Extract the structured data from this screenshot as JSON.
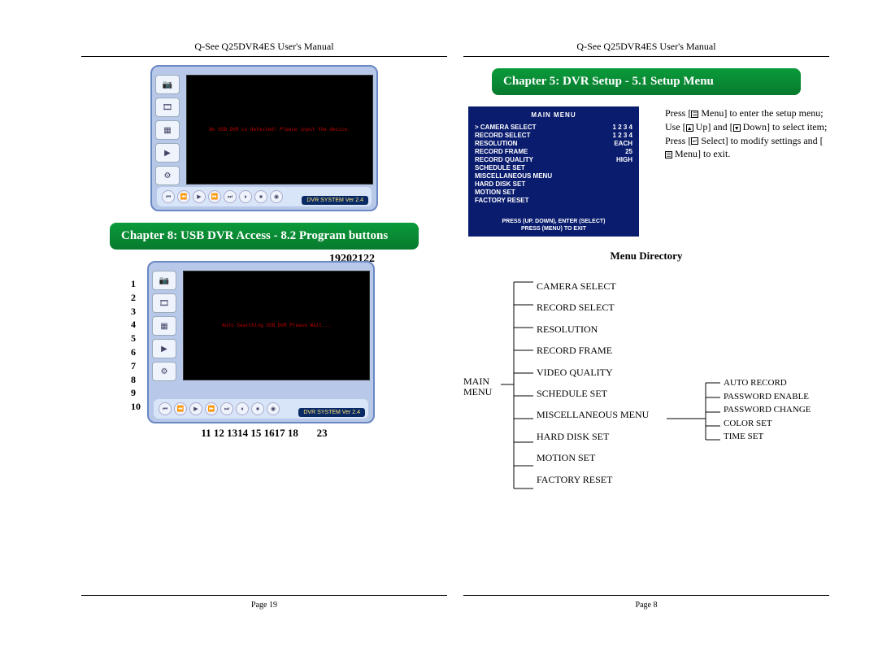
{
  "doc_header": "Q-See Q25DVR4ES User's Manual",
  "left_page": {
    "banner": "Chapter 8: USB DVR Access - 8.2 Program buttons",
    "player": {
      "footer_label": "DVR SYSTEM  Ver 2.4",
      "screen_msg_1": "No USB DVR is detected!  Please input the device.",
      "screen_msg_2": "Auto Searching USB DVR  Please Wait..."
    },
    "annot": {
      "top": "19202122",
      "side": [
        "1",
        "2",
        "3",
        "4",
        "5",
        "6",
        "7",
        "8",
        "9",
        "10"
      ],
      "bottom_a": "11 12 1314 15 1617  18",
      "bottom_b": "23"
    },
    "page_no": "Page 19"
  },
  "right_page": {
    "banner": "Chapter 5: DVR Setup - 5.1 Setup Menu",
    "main_menu": {
      "title": "MAIN MENU",
      "rows": [
        {
          "label": "CAMERA SELECT",
          "value": "1 2 3 4",
          "selected": true
        },
        {
          "label": "RECORD SELECT",
          "value": "1 2 3 4"
        },
        {
          "label": "RESOLUTION",
          "value": "EACH"
        },
        {
          "label": "RECORD FRAME",
          "value": "25"
        },
        {
          "label": "RECORD QUALITY",
          "value": "HIGH"
        },
        {
          "label": "SCHEDULE SET",
          "value": ""
        },
        {
          "label": "MISCELLANEOUS MENU",
          "value": ""
        },
        {
          "label": "HARD DISK SET",
          "value": ""
        },
        {
          "label": "MOTION SET",
          "value": ""
        },
        {
          "label": "FACTORY RESET",
          "value": ""
        }
      ],
      "hint1": "PRESS (UP.  DOWN), ENTER (SELECT)",
      "hint2": "PRESS (MENU) TO EXIT"
    },
    "instructions": {
      "l1a": "Press [",
      "l1b": " Menu] to enter the setup menu;",
      "l2a": "Use [",
      "l2b": " Up] and [",
      "l2c": " Down] to select  item;",
      "l3a": "Press [",
      "l3b": " Select] to modify settings and [",
      "l3c": " Menu] to exit."
    },
    "menu_dir_title": "Menu Directory",
    "menu_dir": {
      "root": "MAIN MENU",
      "lvl1": [
        "CAMERA SELECT",
        "RECORD SELECT",
        "RESOLUTION",
        "RECORD FRAME",
        "VIDEO QUALITY",
        "SCHEDULE SET",
        "MISCELLANEOUS MENU",
        "HARD DISK SET",
        "MOTION SET",
        "FACTORY RESET"
      ],
      "lvl2": [
        "AUTO RECORD",
        "PASSWORD ENABLE",
        "PASSWORD CHANGE",
        "COLOR SET",
        "TIME SET"
      ]
    },
    "page_no": "Page 8"
  },
  "icons": {
    "camera": "📷",
    "film": "🎞",
    "grid": "▦",
    "play": "▶",
    "gear": "⚙"
  }
}
